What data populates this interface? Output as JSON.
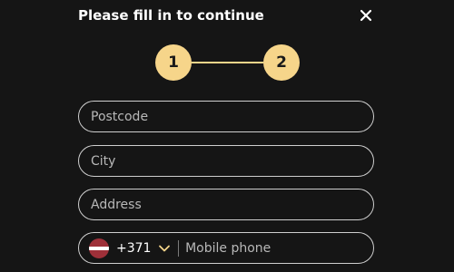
{
  "dialog": {
    "title": "Please fill in to continue",
    "close_icon": "close-icon"
  },
  "stepper": {
    "steps": [
      "1",
      "2"
    ],
    "accent_color": "#f6d58a"
  },
  "form": {
    "postcode": {
      "placeholder": "Postcode",
      "value": ""
    },
    "city": {
      "placeholder": "City",
      "value": ""
    },
    "address": {
      "placeholder": "Address",
      "value": ""
    },
    "phone": {
      "country_flag": "latvia-flag-icon",
      "dial_code": "+371",
      "dropdown_icon": "chevron-down-icon",
      "placeholder": "Mobile phone",
      "value": ""
    }
  },
  "colors": {
    "background": "#151515",
    "text": "#ffffff",
    "border": "#cfcfcf"
  }
}
